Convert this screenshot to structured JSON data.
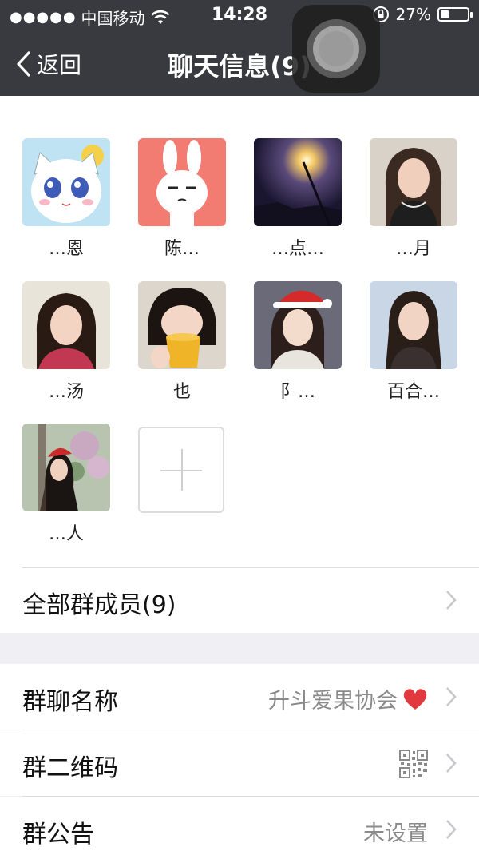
{
  "status": {
    "signal_dots": "●●●●●",
    "carrier": "中国移动",
    "time": "14:28",
    "battery_text": "27%",
    "battery_level": 0.27
  },
  "nav": {
    "back_label": "返回",
    "title": "聊天信息(9)"
  },
  "members": [
    {
      "name": "…恩",
      "avatar": "cat-cartoon-avatar"
    },
    {
      "name": "陈…",
      "avatar": "rabbit-cartoon-avatar"
    },
    {
      "name": "…点…",
      "avatar": "night-sky-avatar"
    },
    {
      "name": "…月",
      "avatar": "girl-portrait-avatar"
    },
    {
      "name": "…汤",
      "avatar": "girl-portrait-avatar"
    },
    {
      "name": "也",
      "avatar": "girl-with-cup-avatar"
    },
    {
      "name": "阝…",
      "avatar": "girl-santa-hat-avatar"
    },
    {
      "name": "百合…",
      "avatar": "girl-portrait-avatar"
    },
    {
      "name": "…人",
      "avatar": "girl-flowers-avatar"
    }
  ],
  "rows": {
    "all_members": {
      "label": "全部群成员(9)"
    },
    "group_name": {
      "label": "群聊名称",
      "value": "升斗爱果协会"
    },
    "qr_code": {
      "label": "群二维码"
    },
    "announcement": {
      "label": "群公告",
      "value": "未设置"
    }
  },
  "colors": {
    "nav_bg": "#393a3f",
    "page_bg": "#efeff4",
    "heart": "#e0393e"
  }
}
